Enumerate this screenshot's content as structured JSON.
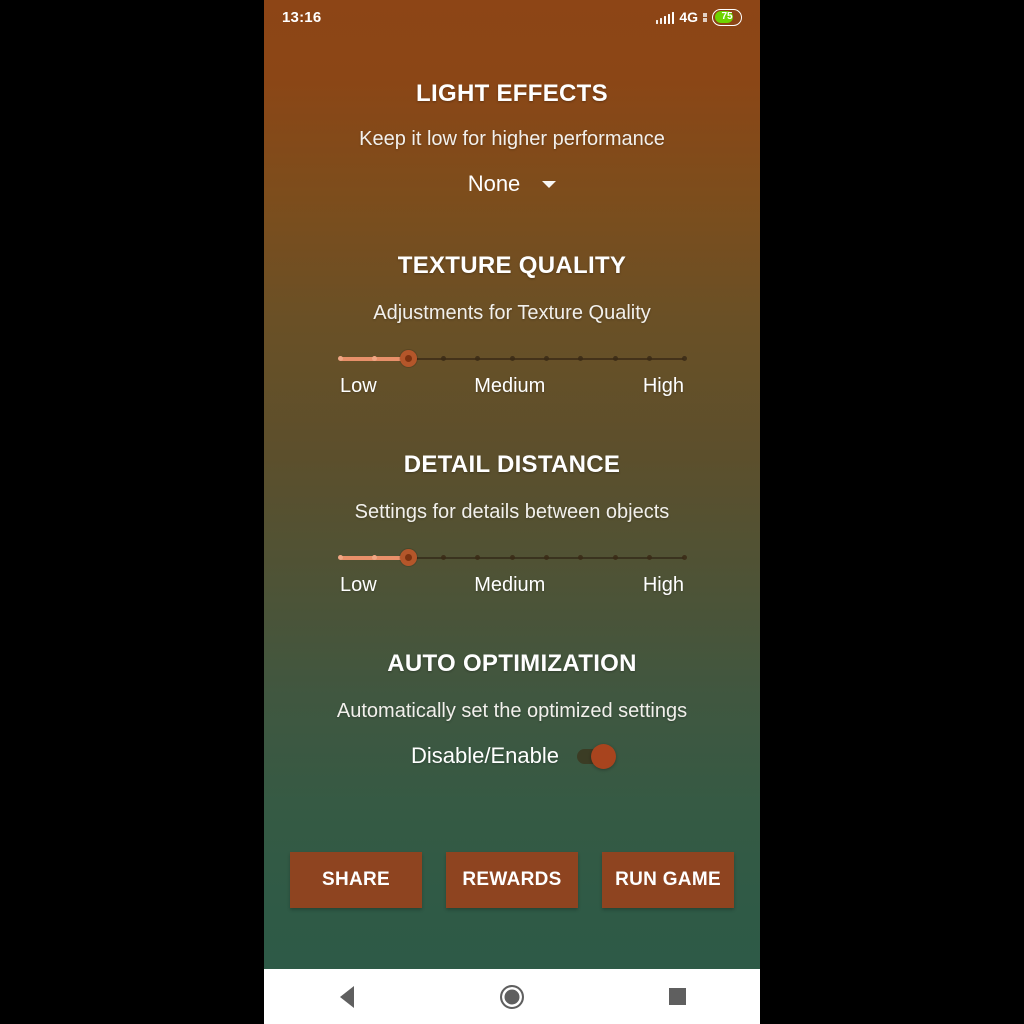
{
  "status_bar": {
    "clock": "13:16",
    "network_type": "4G",
    "battery_percent": "75",
    "signal_icon": "signal-bars-icon",
    "battery_icon": "battery-icon",
    "battery_color": "#6dd400"
  },
  "theme": {
    "gradient_top": "#8d4516",
    "gradient_mid": "#5c4f2c",
    "gradient_bottom": "#2f5a46",
    "button_color": "#8e4420",
    "slider_fill": "#e8906a",
    "slider_thumb": "#b4562a",
    "toggle_knob": "#a8441e"
  },
  "sections": {
    "light_effects": {
      "title": "LIGHT EFFECTS",
      "subtitle": "Keep it low for higher performance",
      "dropdown_value": "None",
      "dropdown_icon": "chevron-down-icon"
    },
    "texture_quality": {
      "title": "TEXTURE QUALITY",
      "subtitle": "Adjustments for Texture Quality",
      "slider": {
        "ticks": 11,
        "value_index": 2,
        "min_label": "Low",
        "mid_label": "Medium",
        "max_label": "High"
      }
    },
    "detail_distance": {
      "title": "DETAIL DISTANCE",
      "subtitle": "Settings for details between objects",
      "slider": {
        "ticks": 11,
        "value_index": 2,
        "min_label": "Low",
        "mid_label": "Medium",
        "max_label": "High"
      }
    },
    "auto_optimization": {
      "title": "AUTO OPTIMIZATION",
      "subtitle": "Automatically set the optimized settings",
      "toggle_label": "Disable/Enable",
      "toggle_state": "on"
    }
  },
  "buttons": {
    "share": "SHARE",
    "rewards": "REWARDS",
    "run_game": "RUN GAME"
  },
  "nav_bar": {
    "back_icon": "back-triangle-icon",
    "home_icon": "home-circle-icon",
    "recents_icon": "recents-square-icon"
  }
}
